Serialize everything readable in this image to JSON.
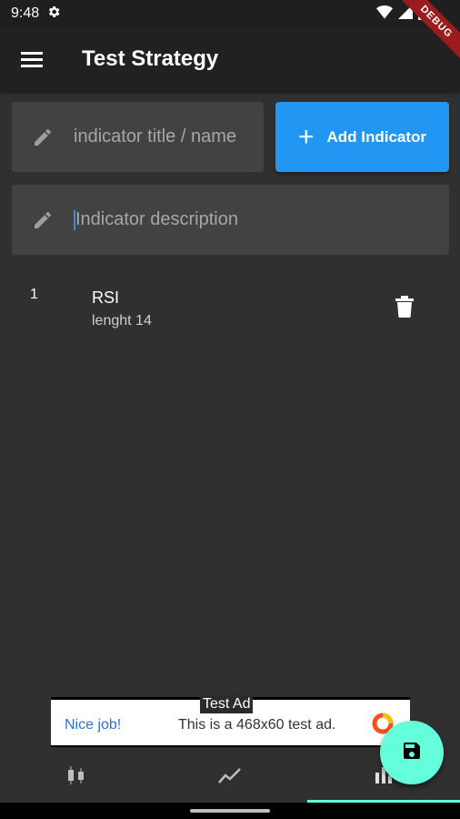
{
  "status_bar": {
    "time": "9:48",
    "icons": [
      "gear-icon",
      "wifi-icon",
      "signal-icon",
      "battery-icon"
    ]
  },
  "debug_ribbon": "DEBUG",
  "app_bar": {
    "title": "Test Strategy",
    "menu_icon": "menu-icon"
  },
  "form": {
    "title_placeholder": "indicator title / name",
    "description_placeholder": "Indicator description",
    "add_button_label": "Add Indicator"
  },
  "indicators": [
    {
      "index": "1",
      "name": "RSI",
      "detail": "lenght 14"
    }
  ],
  "ad_banner": {
    "label": "Test Ad",
    "headline": "Nice job!",
    "text": "This is a 468x60 test ad."
  },
  "fab": {
    "icon": "save-icon"
  },
  "bottom_nav": {
    "items": [
      {
        "icon": "candlestick-icon",
        "active": false
      },
      {
        "icon": "trend-line-icon",
        "active": false
      },
      {
        "icon": "bar-chart-icon",
        "active": true
      }
    ]
  },
  "colors": {
    "background": "#303030",
    "app_bar": "#212121",
    "accent_blue": "#2196f3",
    "fab": "#64ffda",
    "field_bg": "#424242"
  }
}
